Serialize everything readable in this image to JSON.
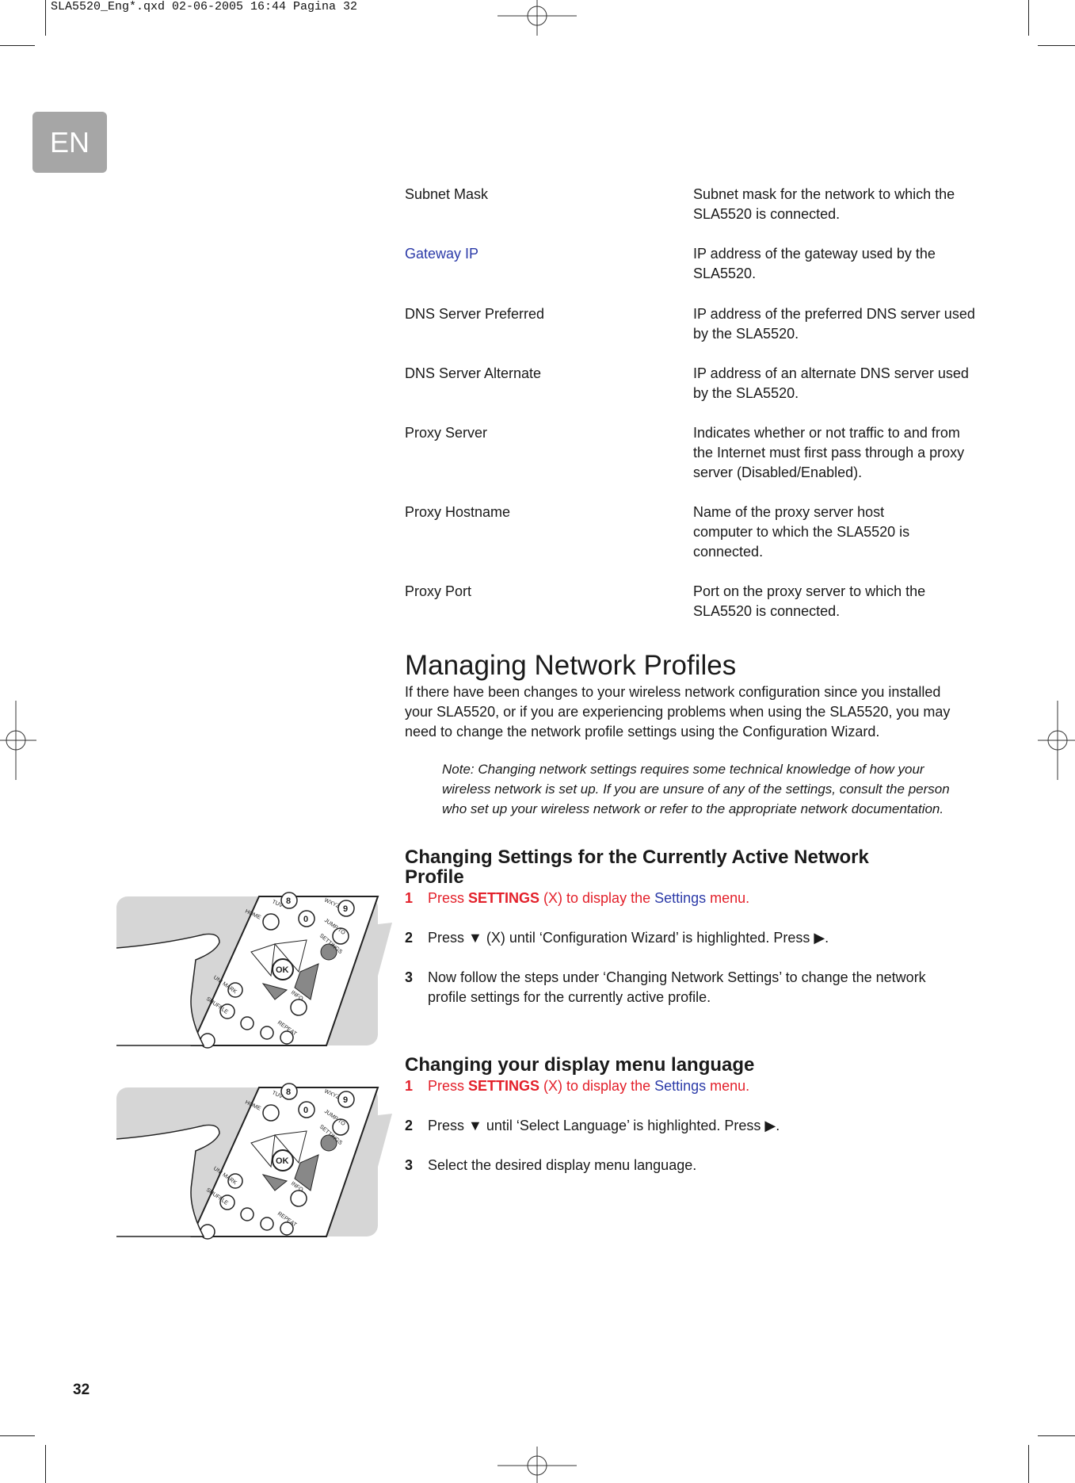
{
  "slug": "SLA5520_Eng*.qxd  02-06-2005  16:44  Pagina 32",
  "language_tab": "EN",
  "settings_table": [
    {
      "term": "Subnet Mask",
      "description": "Subnet mask for the network to which the SLA5520 is connected."
    },
    {
      "term": "Gateway IP",
      "description": "IP address of the gateway used by the SLA5520."
    },
    {
      "term": "DNS Server Preferred",
      "description": "IP address of the preferred DNS server used by the SLA5520."
    },
    {
      "term": "DNS Server Alternate",
      "description": "IP address of an alternate DNS server used by the SLA5520."
    },
    {
      "term": "Proxy Server",
      "description": "Indicates whether or not traffic to and from the Internet must first pass through a proxy server (Disabled/Enabled)."
    },
    {
      "term": "Proxy Hostname",
      "description": "Name of the proxy server host computer to which the SLA5520 is connected."
    },
    {
      "term": "Proxy Port",
      "description": "Port on the proxy server to which the SLA5520 is connected."
    }
  ],
  "section": {
    "title": "Managing Network Profiles",
    "intro": "If there have been changes to your wireless network configuration since you installed your SLA5520, or if you are experiencing problems when using the SLA5520, you may need to change the network profile settings using the Configuration Wizard.",
    "note": "Note: Changing network settings requires some technical knowledge of how your wireless network is set up. If you are unsure of any of the settings, consult the person who set up your wireless network or refer to the appropriate network documentation."
  },
  "subsection1": {
    "title": "Changing Settings for the Currently Active Network Profile",
    "steps": [
      {
        "num": "1",
        "pre": "Press ",
        "bold": "SETTINGS",
        "mid": " (X) to display the ",
        "link": "Settings",
        "post": " menu."
      },
      {
        "num": "2",
        "text": "Press ▼ (X) until ‘Configuration Wizard’ is highlighted. Press ▶."
      },
      {
        "num": "3",
        "text": "Now follow the steps under ‘Changing Network Settings’ to change the network profile settings for the currently active profile."
      }
    ]
  },
  "subsection2": {
    "title": "Changing your display menu language",
    "steps": [
      {
        "num": "1",
        "pre": "Press ",
        "bold": "SETTINGS",
        "mid": " (X) to display the ",
        "link": "Settings",
        "post": " menu."
      },
      {
        "num": "2",
        "text": "Press ▼ until ‘Select Language’ is highlighted. Press ▶."
      },
      {
        "num": "3",
        "text": "Select the desired display menu language."
      }
    ]
  },
  "remote_labels": [
    "TUV",
    "8",
    "WXYZ",
    "9",
    "HOME",
    "0",
    "JUMP TO",
    "SETTINGS",
    "OK",
    "UNI MARK",
    "SHUFFLE",
    "INFO",
    "REPEAT"
  ],
  "page_number": "32",
  "colors": {
    "red": "#e3202a",
    "blue": "#2b3aa8",
    "tab_gray": "#a6a6a6"
  }
}
